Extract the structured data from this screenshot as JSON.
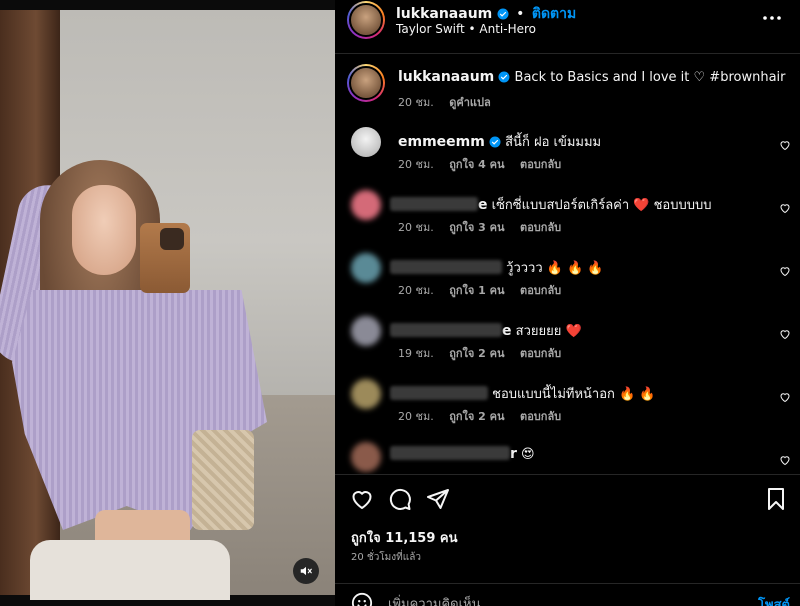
{
  "header": {
    "username": "lukkanaaum",
    "separator": "•",
    "follow_label": "ติดตาม",
    "audio": "Taylor Swift • Anti-Hero",
    "more_icon": "more-dots-icon"
  },
  "caption": {
    "username": "lukkanaaum",
    "text": "Back to Basics and I love it ♡ #brownhair",
    "time": "20 ชม.",
    "translate_label": "ดูคำแปล"
  },
  "comments": [
    {
      "username": "emmeemm",
      "text": "สีนี้ก็ ฝอ เข้มมมม",
      "time": "20 ชม.",
      "likes": "ถูกใจ 4 คน",
      "reply": "ตอบกลับ"
    },
    {
      "username": "",
      "name_tail": "e",
      "text": "เซ็กซี่แบบสปอร์ตเกิร์ลค่า ❤️ ชอบบบบบ",
      "time": "20 ชม.",
      "likes": "ถูกใจ 3 คน",
      "reply": "ตอบกลับ"
    },
    {
      "username": "",
      "name_tail": "",
      "text": "วู้วววว 🔥 🔥 🔥",
      "time": "20 ชม.",
      "likes": "ถูกใจ 1 คน",
      "reply": "ตอบกลับ"
    },
    {
      "username": "",
      "name_tail": "e",
      "text": "สวยยยย ❤️",
      "time": "19 ชม.",
      "likes": "ถูกใจ 2 คน",
      "reply": "ตอบกลับ"
    },
    {
      "username": "",
      "name_tail": "",
      "text": "ชอบแบบนี้ไม่ทีหน้าอก 🔥 🔥",
      "time": "20 ชม.",
      "likes": "ถูกใจ 2 คน",
      "reply": "ตอบกลับ"
    },
    {
      "username": "",
      "name_tail": "r",
      "text": "😍",
      "time": "",
      "likes": "",
      "reply": ""
    }
  ],
  "actions": {
    "like_icon": "heart-icon",
    "comment_icon": "comment-icon",
    "share_icon": "share-icon",
    "save_icon": "bookmark-icon"
  },
  "likes_text": "ถูกใจ 11,159 คน",
  "time_ago": "20 ชั่วโมงที่แล้ว",
  "add_comment": {
    "placeholder": "เพิ่มความคิดเห็น...",
    "post_label": "โพสต์"
  },
  "colors": {
    "accent": "#0095f6",
    "verified": "#0095f6",
    "heart_red": "#ff3040"
  }
}
